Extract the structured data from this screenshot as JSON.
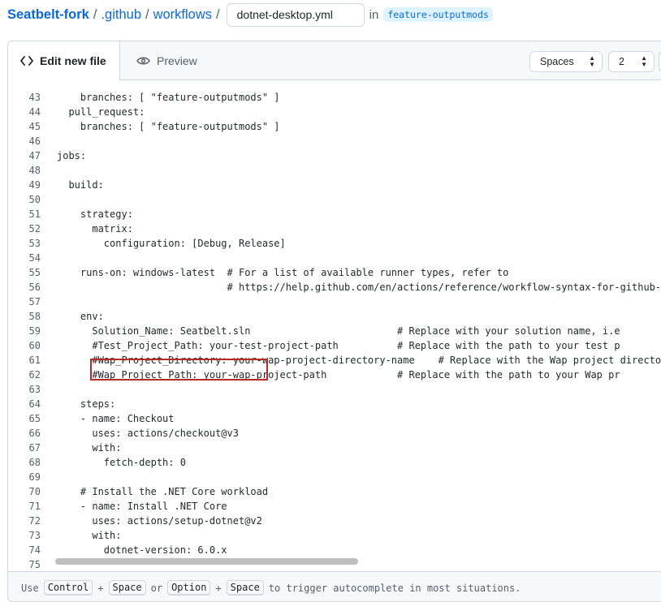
{
  "breadcrumb": {
    "repo": "Seatbelt-fork",
    "sep": "/",
    "dir1": ".github",
    "dir2": "workflows",
    "filename": "dotnet-desktop.yml",
    "in_text": "in",
    "branch": "feature-outputmods"
  },
  "tabs": {
    "edit": "Edit new file",
    "preview": "Preview"
  },
  "toolbar": {
    "indent_mode": "Spaces",
    "indent_size": "2"
  },
  "code_lines": [
    {
      "n": "43",
      "t": "    branches: [ \"feature-outputmods\" ]"
    },
    {
      "n": "44",
      "t": "  pull_request:"
    },
    {
      "n": "45",
      "t": "    branches: [ \"feature-outputmods\" ]"
    },
    {
      "n": "46",
      "t": ""
    },
    {
      "n": "47",
      "t": "jobs:"
    },
    {
      "n": "48",
      "t": ""
    },
    {
      "n": "49",
      "t": "  build:"
    },
    {
      "n": "50",
      "t": ""
    },
    {
      "n": "51",
      "t": "    strategy:"
    },
    {
      "n": "52",
      "t": "      matrix:"
    },
    {
      "n": "53",
      "t": "        configuration: [Debug, Release]"
    },
    {
      "n": "54",
      "t": ""
    },
    {
      "n": "55",
      "t": "    runs-on: windows-latest  # For a list of available runner types, refer to"
    },
    {
      "n": "56",
      "t": "                             # https://help.github.com/en/actions/reference/workflow-syntax-for-github-"
    },
    {
      "n": "57",
      "t": ""
    },
    {
      "n": "58",
      "t": "    env:"
    },
    {
      "n": "59",
      "t": "      Solution_Name: Seatbelt.sln                         # Replace with your solution name, i.e"
    },
    {
      "n": "60",
      "t": "      #Test_Project_Path: your-test-project-path          # Replace with the path to your test p"
    },
    {
      "n": "61",
      "t": "      #Wap_Project_Directory: your-wap-project-directory-name    # Replace with the Wap project directo"
    },
    {
      "n": "62",
      "t": "      #Wap_Project_Path: your-wap-project-path            # Replace with the path to your Wap pr"
    },
    {
      "n": "63",
      "t": ""
    },
    {
      "n": "64",
      "t": "    steps:"
    },
    {
      "n": "65",
      "t": "    - name: Checkout"
    },
    {
      "n": "66",
      "t": "      uses: actions/checkout@v3"
    },
    {
      "n": "67",
      "t": "      with:"
    },
    {
      "n": "68",
      "t": "        fetch-depth: 0"
    },
    {
      "n": "69",
      "t": ""
    },
    {
      "n": "70",
      "t": "    # Install the .NET Core workload"
    },
    {
      "n": "71",
      "t": "    - name: Install .NET Core"
    },
    {
      "n": "72",
      "t": "      uses: actions/setup-dotnet@v2"
    },
    {
      "n": "73",
      "t": "      with:"
    },
    {
      "n": "74",
      "t": "        dotnet-version: 6.0.x"
    },
    {
      "n": "75",
      "t": ""
    }
  ],
  "footer": {
    "use": "Use",
    "key1": "Control",
    "plus": "+",
    "key2": "Space",
    "or": "or",
    "key3": "Option",
    "key4": "Space",
    "tail": "to trigger autocomplete in most situations."
  }
}
